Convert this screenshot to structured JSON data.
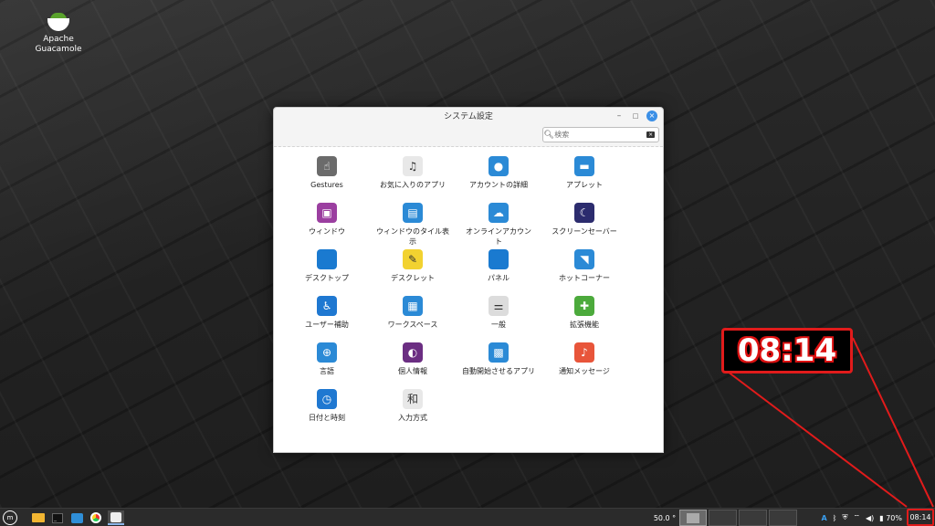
{
  "desktop": {
    "icon_label": "Apache\nGuacamole",
    "icon_label_line1": "Apache",
    "icon_label_line2": "Guacamole"
  },
  "window": {
    "title": "システム設定",
    "controls": {
      "minimize": "–",
      "maximize": "□",
      "close": "×"
    },
    "search_placeholder": "検索",
    "items": [
      {
        "label": "Gestures",
        "icon": "gestures-icon",
        "color": "#6b6b6b",
        "glyph": "☝"
      },
      {
        "label": "お気に入りのアプリ",
        "icon": "favorite-apps-icon",
        "color": "#e8e8e8",
        "glyph": "♫"
      },
      {
        "label": "アカウントの詳細",
        "icon": "account-icon",
        "color": "#2b8ad6",
        "glyph": "●"
      },
      {
        "label": "アプレット",
        "icon": "applets-icon",
        "color": "#2b8ad6",
        "glyph": "▬"
      },
      {
        "label": "ウィンドウ",
        "icon": "windows-icon",
        "color": "#9b3fa0",
        "glyph": "▣"
      },
      {
        "label": "ウィンドウのタイル表示",
        "icon": "window-tiling-icon",
        "color": "#2b8ad6",
        "glyph": "▤"
      },
      {
        "label": "オンラインアカウント",
        "icon": "online-accounts-icon",
        "color": "#2b8ad6",
        "glyph": "☁"
      },
      {
        "label": "スクリーンセーバー",
        "icon": "screensaver-icon",
        "color": "#2c2c6e",
        "glyph": "☾"
      },
      {
        "label": "デスクトップ",
        "icon": "desktop-icon",
        "color": "#1a7ad0",
        "glyph": ""
      },
      {
        "label": "デスクレット",
        "icon": "desklets-icon",
        "color": "#f2d230",
        "glyph": "✎"
      },
      {
        "label": "パネル",
        "icon": "panel-icon",
        "color": "#1a7ad0",
        "glyph": ""
      },
      {
        "label": "ホットコーナー",
        "icon": "hot-corners-icon",
        "color": "#2b8ad6",
        "glyph": "◥"
      },
      {
        "label": "ユーザー補助",
        "icon": "accessibility-icon",
        "color": "#1f78d1",
        "glyph": "♿"
      },
      {
        "label": "ワークスペース",
        "icon": "workspaces-icon",
        "color": "#2b8ad6",
        "glyph": "▦"
      },
      {
        "label": "一般",
        "icon": "general-icon",
        "color": "#dcdcdc",
        "glyph": "⚌"
      },
      {
        "label": "拡張機能",
        "icon": "extensions-icon",
        "color": "#4caa3c",
        "glyph": "✚"
      },
      {
        "label": "言語",
        "icon": "languages-icon",
        "color": "#2b8ad6",
        "glyph": "⊕"
      },
      {
        "label": "個人情報",
        "icon": "privacy-icon",
        "color": "#6b2e82",
        "glyph": "◐"
      },
      {
        "label": "自動開始させるアプリ",
        "icon": "startup-apps-icon",
        "color": "#2b8ad6",
        "glyph": "▩"
      },
      {
        "label": "通知メッセージ",
        "icon": "notifications-icon",
        "color": "#e8553a",
        "glyph": "♪"
      },
      {
        "label": "日付と時刻",
        "icon": "date-time-icon",
        "color": "#1f78d1",
        "glyph": "◷"
      },
      {
        "label": "入力方式",
        "icon": "input-method-icon",
        "color": "#e8e8e8",
        "glyph": "和"
      }
    ]
  },
  "callout": {
    "text": "08:14"
  },
  "taskbar": {
    "temperature": "50.0 °",
    "battery": "70%",
    "keyboard": "A",
    "clock": "08:14"
  }
}
